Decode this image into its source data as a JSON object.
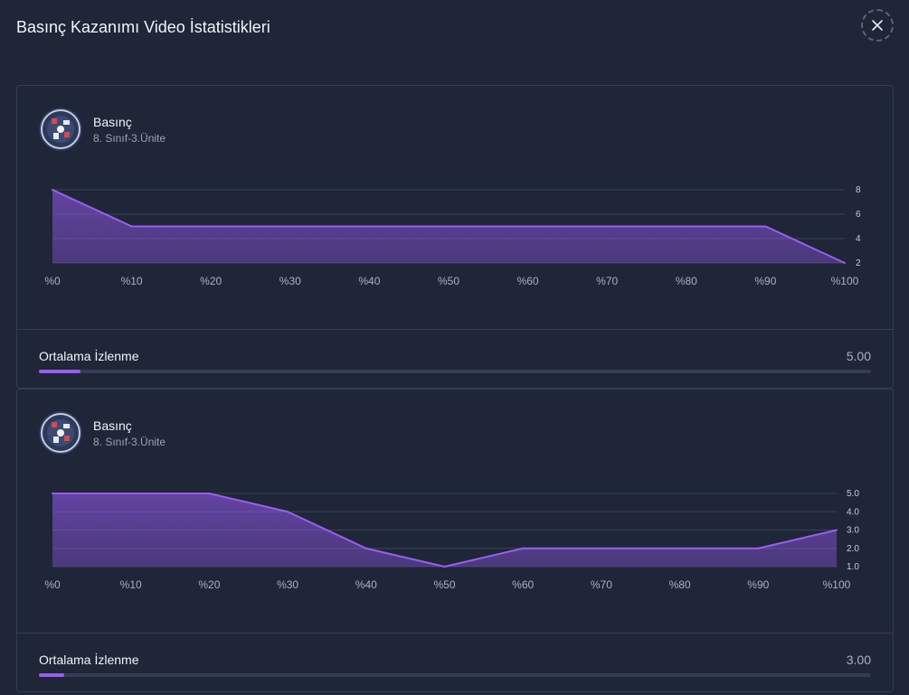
{
  "modal": {
    "title": "Basınç Kazanımı Video İstatistikleri",
    "close_icon": "close-icon"
  },
  "cards": [
    {
      "video_title": "Basınç",
      "video_subtitle": "8. Sınıf-3.Ünite",
      "avg_label": "Ortalama İzlenme",
      "avg_value": "5.00",
      "avg_fraction": 0.05,
      "chart_data": {
        "type": "area",
        "x": [
          "%0",
          "%10",
          "%20",
          "%30",
          "%40",
          "%50",
          "%60",
          "%70",
          "%80",
          "%90",
          "%100"
        ],
        "series": [
          {
            "values": [
              8,
              5,
              5,
              5,
              5,
              5,
              5,
              5,
              5,
              5,
              2
            ]
          }
        ],
        "yticks": [
          "2",
          "4",
          "6",
          "8"
        ],
        "ylim": [
          2,
          8
        ],
        "color": "#9b5cf6"
      }
    },
    {
      "video_title": "Basınç",
      "video_subtitle": "8. Sınıf-3.Ünite",
      "avg_label": "Ortalama İzlenme",
      "avg_value": "3.00",
      "avg_fraction": 0.03,
      "chart_data": {
        "type": "area",
        "x": [
          "%0",
          "%10",
          "%20",
          "%30",
          "%40",
          "%50",
          "%60",
          "%70",
          "%80",
          "%90",
          "%100"
        ],
        "series": [
          {
            "values": [
              5,
              5,
              5,
              4,
              2,
              1,
              2,
              2,
              2,
              2,
              3
            ]
          }
        ],
        "yticks": [
          "1.0",
          "2.0",
          "3.0",
          "4.0",
          "5.0"
        ],
        "ylim": [
          1,
          5
        ],
        "color": "#9b5cf6"
      }
    }
  ]
}
